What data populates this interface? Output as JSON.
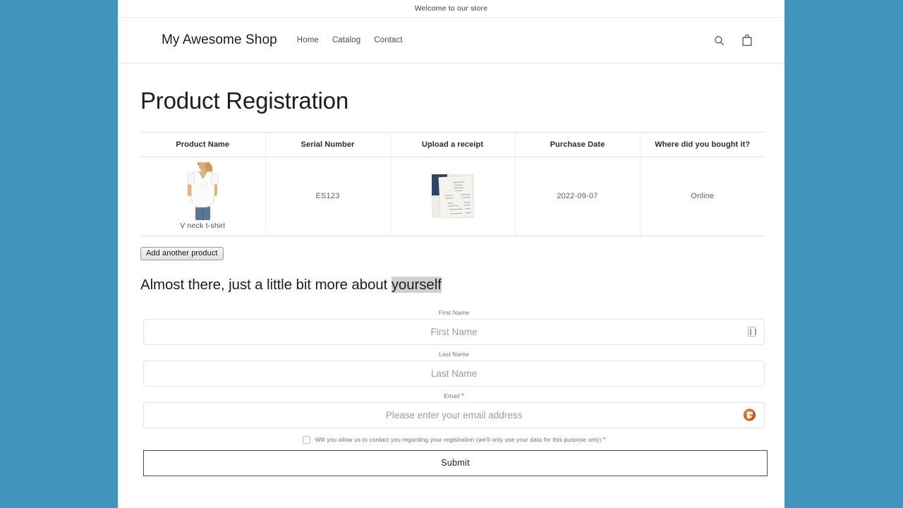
{
  "announcement": {
    "text": "Welcome to our store"
  },
  "header": {
    "logo": "My Awesome Shop",
    "nav": [
      {
        "label": "Home"
      },
      {
        "label": "Catalog"
      },
      {
        "label": "Contact"
      }
    ],
    "icons": {
      "search": "search-icon",
      "cart": "shopping-bag-icon"
    }
  },
  "main": {
    "title": "Product Registration",
    "subheading_plain": "Almost there, just a little bit more about ",
    "subheading_selected": "yourself",
    "add_product_button": "Add another product"
  },
  "table": {
    "columns": [
      "Product Name",
      "Serial Number",
      "Upload a receipt",
      "Purchase Date",
      "Where did you bought it?"
    ],
    "rows": [
      {
        "product_name": "V neck t-shirt",
        "product_image": "white-v-neck-tshirt-photo",
        "serial_number": "ES123",
        "receipt": "receipt-photo-thumbnail",
        "purchase_date": "2022-09-07",
        "where_bought": "Online"
      }
    ]
  },
  "form": {
    "fields": [
      {
        "label": "First Name",
        "required": false,
        "value": "",
        "placeholder": "First Name",
        "trailing_icon": "autofill-card-icon"
      },
      {
        "label": "Last Name",
        "required": false,
        "value": "",
        "placeholder": "Last Name",
        "trailing_icon": ""
      },
      {
        "label": "Email",
        "required": true,
        "value": "",
        "placeholder": "Please enter your email address",
        "trailing_icon": "password-manager-badge-icon"
      }
    ],
    "required_marker": "*",
    "consent": {
      "checked": false,
      "text": "Will you allow us to contact you regarding your registration (we'll only use your data for this purpose only)",
      "required_marker": "*"
    },
    "submit_label": "Submit"
  },
  "colors": {
    "page_background": "#4094bd",
    "content_background": "#ffffff",
    "text_primary": "#1c1d1d",
    "text_muted": "#6f6f6f",
    "required_red": "#e02b20",
    "border": "#e3e3e3",
    "selection_highlight": "#d0d0d0",
    "receipt_navy": "#2e4663",
    "extension_badge_orange": "#d2641f"
  }
}
